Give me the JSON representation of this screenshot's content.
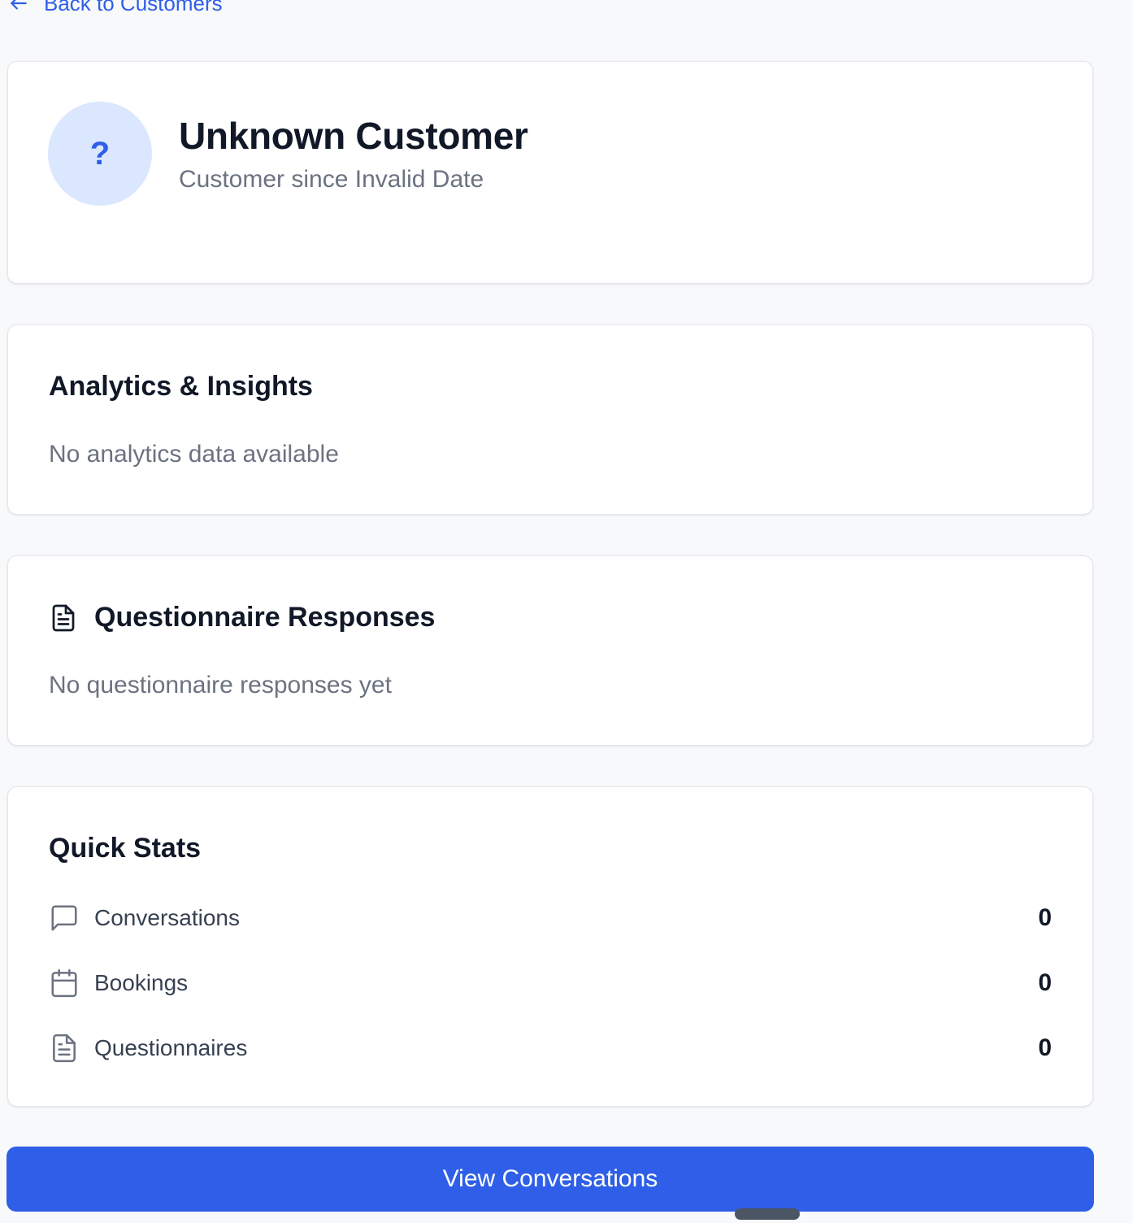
{
  "nav": {
    "back_label": "Back to Customers"
  },
  "profile": {
    "avatar_glyph": "?",
    "name": "Unknown Customer",
    "subtitle": "Customer since Invalid Date"
  },
  "analytics": {
    "title": "Analytics & Insights",
    "empty_text": "No analytics data available"
  },
  "questionnaire": {
    "title": "Questionnaire Responses",
    "icon": "file-text-icon",
    "empty_text": "No questionnaire responses yet"
  },
  "quick_stats": {
    "title": "Quick Stats",
    "items": [
      {
        "label": "Conversations",
        "value": "0",
        "icon": "message-square-icon"
      },
      {
        "label": "Bookings",
        "value": "0",
        "icon": "calendar-icon"
      },
      {
        "label": "Questionnaires",
        "value": "0",
        "icon": "file-text-icon"
      }
    ]
  },
  "actions": {
    "primary_label": "View Conversations"
  },
  "colors": {
    "accent": "#2f5fe8",
    "avatar_bg": "#dbe7fe",
    "background": "#f8f9fb",
    "muted_text": "#6b7280"
  }
}
